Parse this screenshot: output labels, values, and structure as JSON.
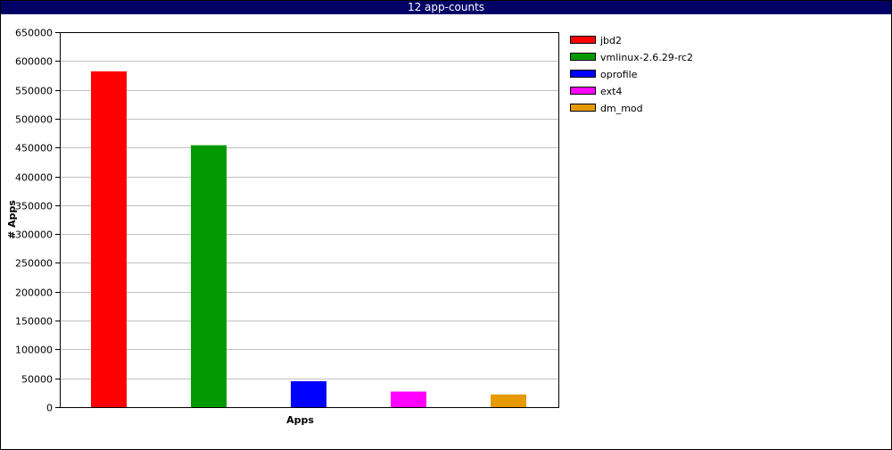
{
  "window": {
    "title": "12 app-counts"
  },
  "chart_data": {
    "type": "bar",
    "title": "12 app-counts",
    "xlabel": "Apps",
    "ylabel": "# Apps",
    "ylim": [
      0,
      650000
    ],
    "yticks": [
      0,
      50000,
      100000,
      150000,
      200000,
      250000,
      300000,
      350000,
      400000,
      450000,
      500000,
      550000,
      600000,
      650000
    ],
    "grid": true,
    "legend_position": "right",
    "series": [
      {
        "name": "jbd2",
        "value": 582000,
        "color": "#ff0000"
      },
      {
        "name": "vmlinux-2.6.29-rc2",
        "value": 454000,
        "color": "#009900"
      },
      {
        "name": "oprofile",
        "value": 45000,
        "color": "#0000ff"
      },
      {
        "name": "ext4",
        "value": 27000,
        "color": "#ff00ff"
      },
      {
        "name": "dm_mod",
        "value": 22000,
        "color": "#e69a00"
      }
    ]
  }
}
